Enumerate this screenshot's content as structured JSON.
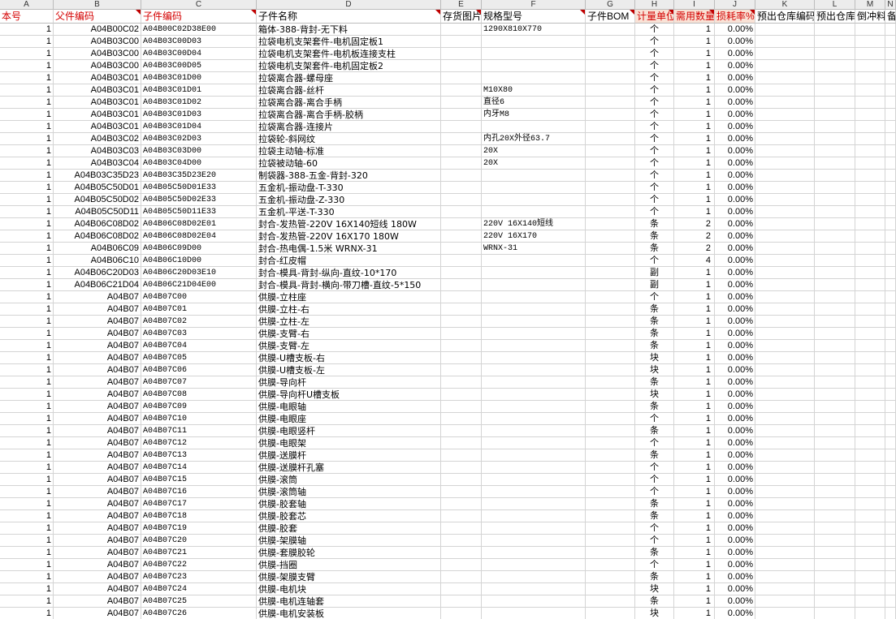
{
  "column_letters": [
    "A",
    "B",
    "C",
    "D",
    "E",
    "F",
    "G",
    "H",
    "I",
    "J",
    "K",
    "L",
    "M",
    "N"
  ],
  "headers": [
    "本号",
    "父件编码",
    "子件编码",
    "子件名称",
    "存货图片",
    "规格型号",
    "子件BOM",
    "计量单位",
    "需用数量",
    "损耗率%",
    "预出仓库编码",
    "预出仓库",
    "倒冲料",
    "备注"
  ],
  "rows": [
    [
      "1",
      "A04B00C02",
      "A04B00C02D38E00",
      "箱体-388-背封-无下料",
      "",
      "1290X810X770",
      "",
      "个",
      "1",
      "0.00%"
    ],
    [
      "1",
      "A04B03C00",
      "A04B03C00D03",
      "拉袋电机支架套件-电机固定板1",
      "",
      "",
      "",
      "个",
      "1",
      "0.00%"
    ],
    [
      "1",
      "A04B03C00",
      "A04B03C00D04",
      "拉袋电机支架套件-电机板连接支柱",
      "",
      "",
      "",
      "个",
      "1",
      "0.00%"
    ],
    [
      "1",
      "A04B03C00",
      "A04B03C00D05",
      "拉袋电机支架套件-电机固定板2",
      "",
      "",
      "",
      "个",
      "1",
      "0.00%"
    ],
    [
      "1",
      "A04B03C01",
      "A04B03C01D00",
      "拉袋离合器-螺母座",
      "",
      "",
      "",
      "个",
      "1",
      "0.00%"
    ],
    [
      "1",
      "A04B03C01",
      "A04B03C01D01",
      "拉袋离合器-丝杆",
      "",
      "M10X80",
      "",
      "个",
      "1",
      "0.00%"
    ],
    [
      "1",
      "A04B03C01",
      "A04B03C01D02",
      "拉袋离合器-离合手柄",
      "",
      "直径6",
      "",
      "个",
      "1",
      "0.00%"
    ],
    [
      "1",
      "A04B03C01",
      "A04B03C01D03",
      "拉袋离合器-离合手柄-胶柄",
      "",
      "内牙M8",
      "",
      "个",
      "1",
      "0.00%"
    ],
    [
      "1",
      "A04B03C01",
      "A04B03C01D04",
      "拉袋离合器-连接片",
      "",
      "",
      "",
      "个",
      "1",
      "0.00%"
    ],
    [
      "1",
      "A04B03C02",
      "A04B03C02D03",
      "拉袋轮-斜网纹",
      "",
      "内孔20X外径63.7",
      "",
      "个",
      "1",
      "0.00%"
    ],
    [
      "1",
      "A04B03C03",
      "A04B03C03D00",
      "拉袋主动轴-标准",
      "",
      "20X",
      "",
      "个",
      "1",
      "0.00%"
    ],
    [
      "1",
      "A04B03C04",
      "A04B03C04D00",
      "拉袋被动轴-60",
      "",
      "20X",
      "",
      "个",
      "1",
      "0.00%"
    ],
    [
      "1",
      "A04B03C35D23",
      "A04B03C35D23E20",
      "制袋器-388-五金-背封-320",
      "",
      "",
      "",
      "个",
      "1",
      "0.00%"
    ],
    [
      "1",
      "A04B05C50D01",
      "A04B05C50D01E33",
      "五金机-振动盘-T-330",
      "",
      "",
      "",
      "个",
      "1",
      "0.00%"
    ],
    [
      "1",
      "A04B05C50D02",
      "A04B05C50D02E33",
      "五金机-振动盘-Z-330",
      "",
      "",
      "",
      "个",
      "1",
      "0.00%"
    ],
    [
      "1",
      "A04B05C50D11",
      "A04B05C50D11E33",
      "五金机-平送-T-330",
      "",
      "",
      "",
      "个",
      "1",
      "0.00%"
    ],
    [
      "1",
      "A04B06C08D02",
      "A04B06C08D02E01",
      "封合-发热管-220V 16X140短线 180W",
      "",
      "220V 16X140短线",
      "",
      "条",
      "2",
      "0.00%"
    ],
    [
      "1",
      "A04B06C08D02",
      "A04B06C08D02E04",
      "封合-发热管-220V 16X170 180W",
      "",
      "220V 16X170",
      "",
      "条",
      "2",
      "0.00%"
    ],
    [
      "1",
      "A04B06C09",
      "A04B06C09D00",
      "封合-热电偶-1.5米 WRNX-31",
      "",
      "WRNX-31",
      "",
      "条",
      "2",
      "0.00%"
    ],
    [
      "1",
      "A04B06C10",
      "A04B06C10D00",
      "封合-红皮帽",
      "",
      "",
      "",
      "个",
      "4",
      "0.00%"
    ],
    [
      "1",
      "A04B06C20D03",
      "A04B06C20D03E10",
      "封合-模具-背封-纵向-直纹-10*170",
      "",
      "",
      "",
      "副",
      "1",
      "0.00%"
    ],
    [
      "1",
      "A04B06C21D04",
      "A04B06C21D04E00",
      "封合-模具-背封-横向-带刀槽-直纹-5*150",
      "",
      "",
      "",
      "副",
      "1",
      "0.00%"
    ],
    [
      "1",
      "A04B07",
      "A04B07C00",
      "供膜-立柱座",
      "",
      "",
      "",
      "个",
      "1",
      "0.00%"
    ],
    [
      "1",
      "A04B07",
      "A04B07C01",
      "供膜-立柱-右",
      "",
      "",
      "",
      "条",
      "1",
      "0.00%"
    ],
    [
      "1",
      "A04B07",
      "A04B07C02",
      "供膜-立柱-左",
      "",
      "",
      "",
      "条",
      "1",
      "0.00%"
    ],
    [
      "1",
      "A04B07",
      "A04B07C03",
      "供膜-支臂-右",
      "",
      "",
      "",
      "条",
      "1",
      "0.00%"
    ],
    [
      "1",
      "A04B07",
      "A04B07C04",
      "供膜-支臂-左",
      "",
      "",
      "",
      "条",
      "1",
      "0.00%"
    ],
    [
      "1",
      "A04B07",
      "A04B07C05",
      "供膜-U槽支板-右",
      "",
      "",
      "",
      "块",
      "1",
      "0.00%"
    ],
    [
      "1",
      "A04B07",
      "A04B07C06",
      "供膜-U槽支板-左",
      "",
      "",
      "",
      "块",
      "1",
      "0.00%"
    ],
    [
      "1",
      "A04B07",
      "A04B07C07",
      "供膜-导向杆",
      "",
      "",
      "",
      "条",
      "1",
      "0.00%"
    ],
    [
      "1",
      "A04B07",
      "A04B07C08",
      "供膜-导向杆U槽支板",
      "",
      "",
      "",
      "块",
      "1",
      "0.00%"
    ],
    [
      "1",
      "A04B07",
      "A04B07C09",
      "供膜-电眼轴",
      "",
      "",
      "",
      "条",
      "1",
      "0.00%"
    ],
    [
      "1",
      "A04B07",
      "A04B07C10",
      "供膜-电眼座",
      "",
      "",
      "",
      "个",
      "1",
      "0.00%"
    ],
    [
      "1",
      "A04B07",
      "A04B07C11",
      "供膜-电眼竖杆",
      "",
      "",
      "",
      "条",
      "1",
      "0.00%"
    ],
    [
      "1",
      "A04B07",
      "A04B07C12",
      "供膜-电眼架",
      "",
      "",
      "",
      "个",
      "1",
      "0.00%"
    ],
    [
      "1",
      "A04B07",
      "A04B07C13",
      "供膜-送膜杆",
      "",
      "",
      "",
      "条",
      "1",
      "0.00%"
    ],
    [
      "1",
      "A04B07",
      "A04B07C14",
      "供膜-送膜杆孔塞",
      "",
      "",
      "",
      "个",
      "1",
      "0.00%"
    ],
    [
      "1",
      "A04B07",
      "A04B07C15",
      "供膜-滚筒",
      "",
      "",
      "",
      "个",
      "1",
      "0.00%"
    ],
    [
      "1",
      "A04B07",
      "A04B07C16",
      "供膜-滚筒轴",
      "",
      "",
      "",
      "个",
      "1",
      "0.00%"
    ],
    [
      "1",
      "A04B07",
      "A04B07C17",
      "供膜-胶套轴",
      "",
      "",
      "",
      "条",
      "1",
      "0.00%"
    ],
    [
      "1",
      "A04B07",
      "A04B07C18",
      "供膜-胶套芯",
      "",
      "",
      "",
      "条",
      "1",
      "0.00%"
    ],
    [
      "1",
      "A04B07",
      "A04B07C19",
      "供膜-胶套",
      "",
      "",
      "",
      "个",
      "1",
      "0.00%"
    ],
    [
      "1",
      "A04B07",
      "A04B07C20",
      "供膜-架膜轴",
      "",
      "",
      "",
      "个",
      "1",
      "0.00%"
    ],
    [
      "1",
      "A04B07",
      "A04B07C21",
      "供膜-套膜胶轮",
      "",
      "",
      "",
      "条",
      "1",
      "0.00%"
    ],
    [
      "1",
      "A04B07",
      "A04B07C22",
      "供膜-挡圈",
      "",
      "",
      "",
      "个",
      "1",
      "0.00%"
    ],
    [
      "1",
      "A04B07",
      "A04B07C23",
      "供膜-架膜支臂",
      "",
      "",
      "",
      "条",
      "1",
      "0.00%"
    ],
    [
      "1",
      "A04B07",
      "A04B07C24",
      "供膜-电机块",
      "",
      "",
      "",
      "块",
      "1",
      "0.00%"
    ],
    [
      "1",
      "A04B07",
      "A04B07C25",
      "供膜-电机连轴套",
      "",
      "",
      "",
      "条",
      "1",
      "0.00%"
    ],
    [
      "1",
      "A04B07",
      "A04B07C26",
      "供膜-电机安装板",
      "",
      "",
      "",
      "块",
      "1",
      "0.00%"
    ]
  ]
}
